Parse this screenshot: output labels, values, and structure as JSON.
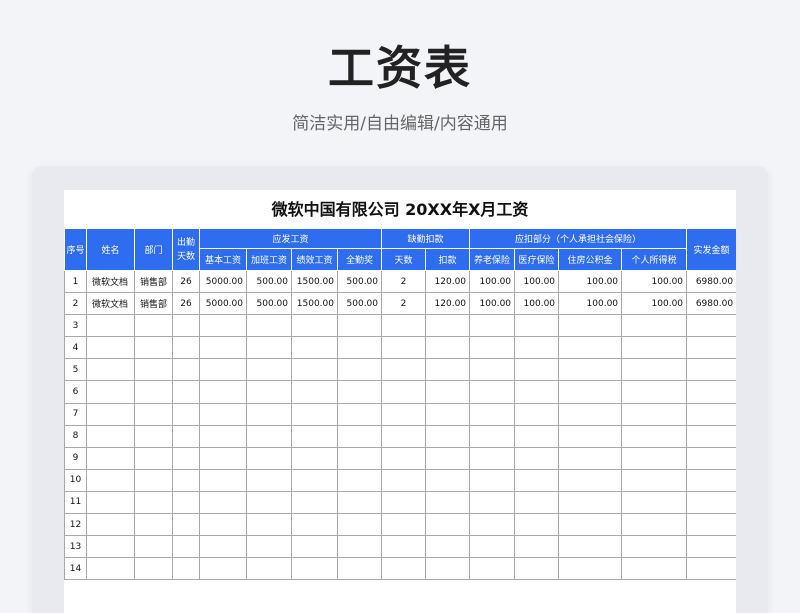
{
  "header": {
    "title": "工资表",
    "subtitle": "简洁实用/自由编辑/内容通用"
  },
  "sheet": {
    "title": "微软中国有限公司 20XX年X月工资",
    "headers": {
      "seq": "序号",
      "name": "姓名",
      "dept": "部门",
      "attendance_line1": "出勤",
      "attendance_line2": "天数",
      "gross_group": "应发工资",
      "gross_base": "基本工资",
      "gross_overtime": "加班工资",
      "gross_performance": "绩效工资",
      "gross_attendance_bonus": "全勤奖",
      "absence_group": "缺勤扣款",
      "absence_days": "天数",
      "absence_deduction": "扣款",
      "withhold_group": "应扣部分（个人承担社会保险）",
      "withhold_pension": "养老保险",
      "withhold_medical": "医疗保险",
      "withhold_housing": "住房公积金",
      "withhold_tax": "个人所得税",
      "net_pay": "实发金额"
    },
    "rows": [
      {
        "seq": "1",
        "name": "微软文档",
        "dept": "销售部",
        "days": "26",
        "base": "5000.00",
        "overtime": "500.00",
        "performance": "1500.00",
        "bonus": "500.00",
        "absent_days": "2",
        "absent_deduct": "120.00",
        "pension": "100.00",
        "medical": "100.00",
        "housing": "100.00",
        "tax": "100.00",
        "net": "6980.00"
      },
      {
        "seq": "2",
        "name": "微软文档",
        "dept": "销售部",
        "days": "26",
        "base": "5000.00",
        "overtime": "500.00",
        "performance": "1500.00",
        "bonus": "500.00",
        "absent_days": "2",
        "absent_deduct": "120.00",
        "pension": "100.00",
        "medical": "100.00",
        "housing": "100.00",
        "tax": "100.00",
        "net": "6980.00"
      },
      {
        "seq": "3"
      },
      {
        "seq": "4"
      },
      {
        "seq": "5"
      },
      {
        "seq": "6"
      },
      {
        "seq": "7"
      },
      {
        "seq": "8"
      },
      {
        "seq": "9"
      },
      {
        "seq": "10"
      },
      {
        "seq": "11"
      },
      {
        "seq": "12"
      },
      {
        "seq": "13"
      },
      {
        "seq": "14"
      }
    ]
  }
}
